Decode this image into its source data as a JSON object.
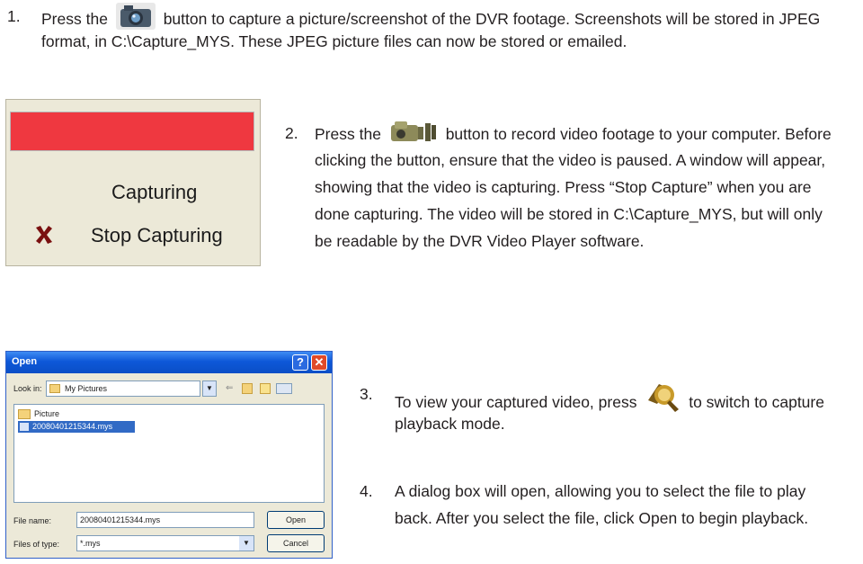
{
  "step1": {
    "number": "1.",
    "before_icon": "Press the",
    "after_icon": "button to capture a picture/screenshot of the DVR footage.  Screenshots will be stored in JPEG",
    "line2": "format, in C:\\Capture_MYS. These JPEG picture files can now be stored or emailed.",
    "icon": "camera-icon"
  },
  "capture_panel": {
    "status": "Capturing",
    "stop_label": "Stop Capturing",
    "bar_color": "#ef3840"
  },
  "step2": {
    "number": "2.",
    "before_icon": "Press the",
    "after_icon": "button to record video footage to your computer. Before",
    "lines": [
      "clicking the button, ensure that the video is paused. A window will appear,",
      "showing that the video is capturing. Press “Stop Capture” when you are",
      "done capturing. The video will be stored in C:\\Capture_MYS, but will only",
      "be readable by the DVR Video Player software."
    ],
    "icon": "video-camera-icon"
  },
  "open_dialog": {
    "title": "Open",
    "look_in_label": "Look in:",
    "look_in_value": "My Pictures",
    "folder_item": "Picture",
    "file_item": "20080401215344.mys",
    "file_name_label": "File name:",
    "file_name_value": "20080401215344.mys",
    "files_of_type_label": "Files of type:",
    "files_of_type_value": "*.mys",
    "open_button": "Open",
    "cancel_button": "Cancel",
    "help_glyph": "?",
    "close_glyph": "✕"
  },
  "step3": {
    "number": "3.",
    "before_icon": "To view your captured video, press",
    "after_icon": "to switch to capture",
    "line2": "playback mode.",
    "icon": "playback-search-icon"
  },
  "step4": {
    "number": "4.",
    "lines": [
      "A dialog box will open, allowing you to select the file to play",
      "back. After you select the file, click Open to begin playback."
    ]
  }
}
